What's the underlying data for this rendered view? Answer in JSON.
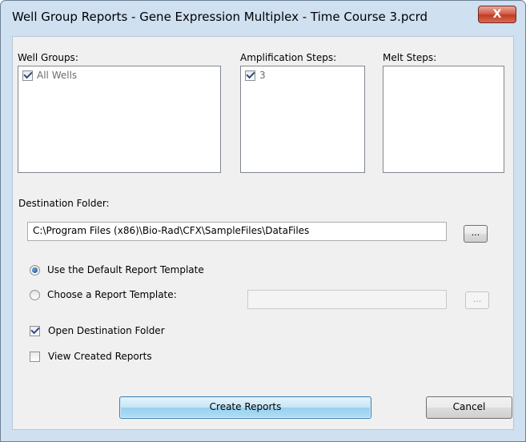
{
  "window": {
    "title": "Well Group Reports - Gene Expression Multiplex - Time Course 3.pcrd",
    "close_glyph": "X"
  },
  "well_groups": {
    "label": "Well Groups:",
    "items": [
      {
        "label": "All Wells",
        "checked": true
      }
    ]
  },
  "amplification_steps": {
    "label": "Amplification Steps:",
    "items": [
      {
        "label": "3",
        "checked": true
      }
    ]
  },
  "melt_steps": {
    "label": "Melt Steps:",
    "items": []
  },
  "destination": {
    "label": "Destination Folder:",
    "value": "C:\\Program Files (x86)\\Bio-Rad\\CFX\\SampleFiles\\DataFiles",
    "browse_label": "..."
  },
  "template_options": {
    "default_label": "Use the Default Report Template",
    "default_selected": true,
    "choose_label": "Choose a Report Template:",
    "choose_selected": false,
    "choose_value": "",
    "browse_label": "..."
  },
  "options": {
    "open_folder_label": "Open Destination Folder",
    "open_folder_checked": true,
    "view_reports_label": "View Created Reports",
    "view_reports_checked": false
  },
  "buttons": {
    "create_label": "Create Reports",
    "cancel_label": "Cancel"
  }
}
